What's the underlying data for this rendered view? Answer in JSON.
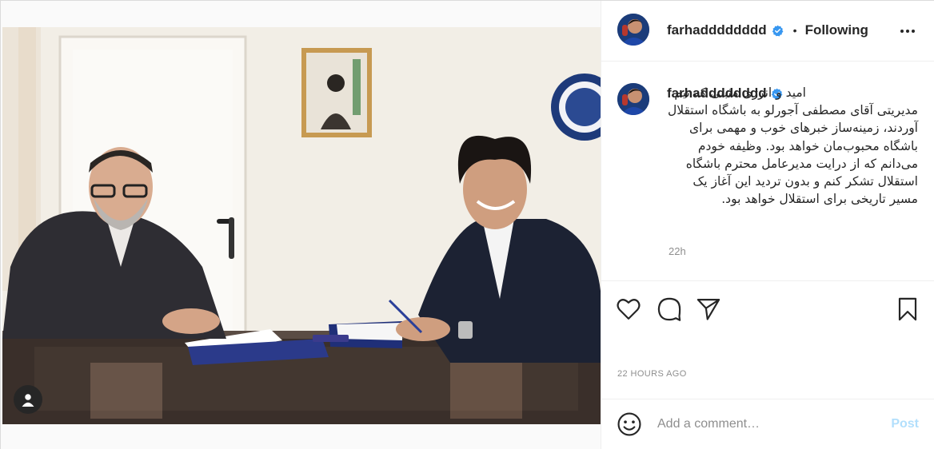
{
  "post": {
    "username": "farhadddddddd",
    "follow_status": "Following",
    "separator": "•",
    "caption_username": "farhadddddddd",
    "caption_text": "امید و انرژی مثبتی که تیم مدیریتی آقای مصطفی آجورلو به باشگاه استقلال آوردند، زمینه‌ساز خبرهای خوب و مهمی برای باشگاه محبوب‌مان خواهد بود. وظیفه خودم می‌دانم که از درایت مدیرعامل محترم باشگاه استقلال تشکر کنم و بدون تردید این آغاز یک مسیر تاریخی برای استقلال خواهد بود.",
    "relative_time": "22h",
    "timestamp": "22 HOURS AGO"
  },
  "comment": {
    "placeholder": "Add a comment…",
    "post_label": "Post"
  },
  "icons": {
    "verified": "verified-badge-icon",
    "more": "more-options-icon",
    "like": "heart-icon",
    "comment": "comment-bubble-icon",
    "share": "paper-plane-icon",
    "save": "bookmark-icon",
    "emoji": "emoji-icon",
    "user_tags": "user-tag-icon"
  },
  "colors": {
    "verified_blue": "#3897f0",
    "post_disabled": "#b2dffc",
    "muted_text": "#8e8e8e",
    "border": "#efefef"
  }
}
